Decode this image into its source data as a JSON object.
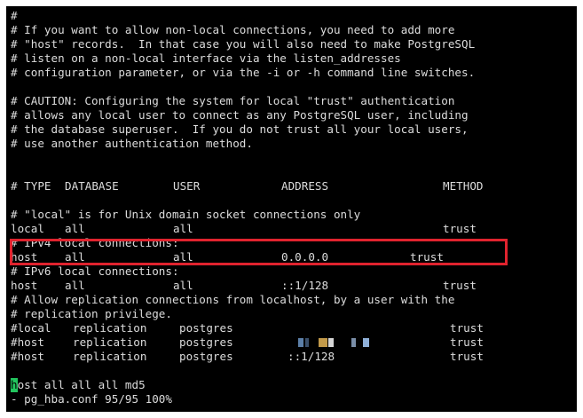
{
  "terminal": {
    "comment_lines": [
      "#",
      "# If you want to allow non-local connections, you need to add more",
      "# \"host\" records.  In that case you will also need to make PostgreSQL",
      "# listen on a non-local interface via the listen_addresses",
      "# configuration parameter, or via the -i or -h command line switches.",
      "",
      "# CAUTION: Configuring the system for local \"trust\" authentication",
      "# allows any local user to connect as any PostgreSQL user, including",
      "# the database superuser.  If you do not trust all your local users,",
      "# use another authentication method."
    ],
    "header": {
      "type": "# TYPE",
      "database": "DATABASE",
      "user": "USER",
      "address": "ADDRESS",
      "method": "METHOD"
    },
    "local_comment": "# \"local\" is for Unix domain socket connections only",
    "local_row": {
      "type": "local",
      "database": "all",
      "user": "all",
      "address": "",
      "method": "trust"
    },
    "ipv4_comment": "# IPv4 local connections:",
    "ipv4_row": {
      "type": "host",
      "database": "all",
      "user": "all",
      "address": "0.0.0.0",
      "method": "trust"
    },
    "ipv6_comment": "# IPv6 local connections:",
    "ipv6_row": {
      "type": "host",
      "database": "all",
      "user": "all",
      "address": "::1/128",
      "method": "trust"
    },
    "replication_comment_1": "# Allow replication connections from localhost, by a user with the",
    "replication_comment_2": "# replication privilege.",
    "rep_rows": [
      {
        "type": "#local",
        "database": "replication",
        "user": "postgres",
        "address": "",
        "method": "trust"
      },
      {
        "type": "#host",
        "database": "replication",
        "user": "postgres",
        "address": "",
        "method": "trust"
      },
      {
        "type": "#host",
        "database": "replication",
        "user": "postgres",
        "address": "::1/128",
        "method": "trust"
      }
    ],
    "last_line": {
      "cursor_char": "h",
      "rest": "ost all all all md5"
    },
    "status_line": "- pg_hba.conf 95/95 100%"
  },
  "colors": {
    "highlight_border": "#e0232e",
    "cursor": "#22c55e",
    "background": "#000000",
    "text": "#dcdcdc"
  }
}
